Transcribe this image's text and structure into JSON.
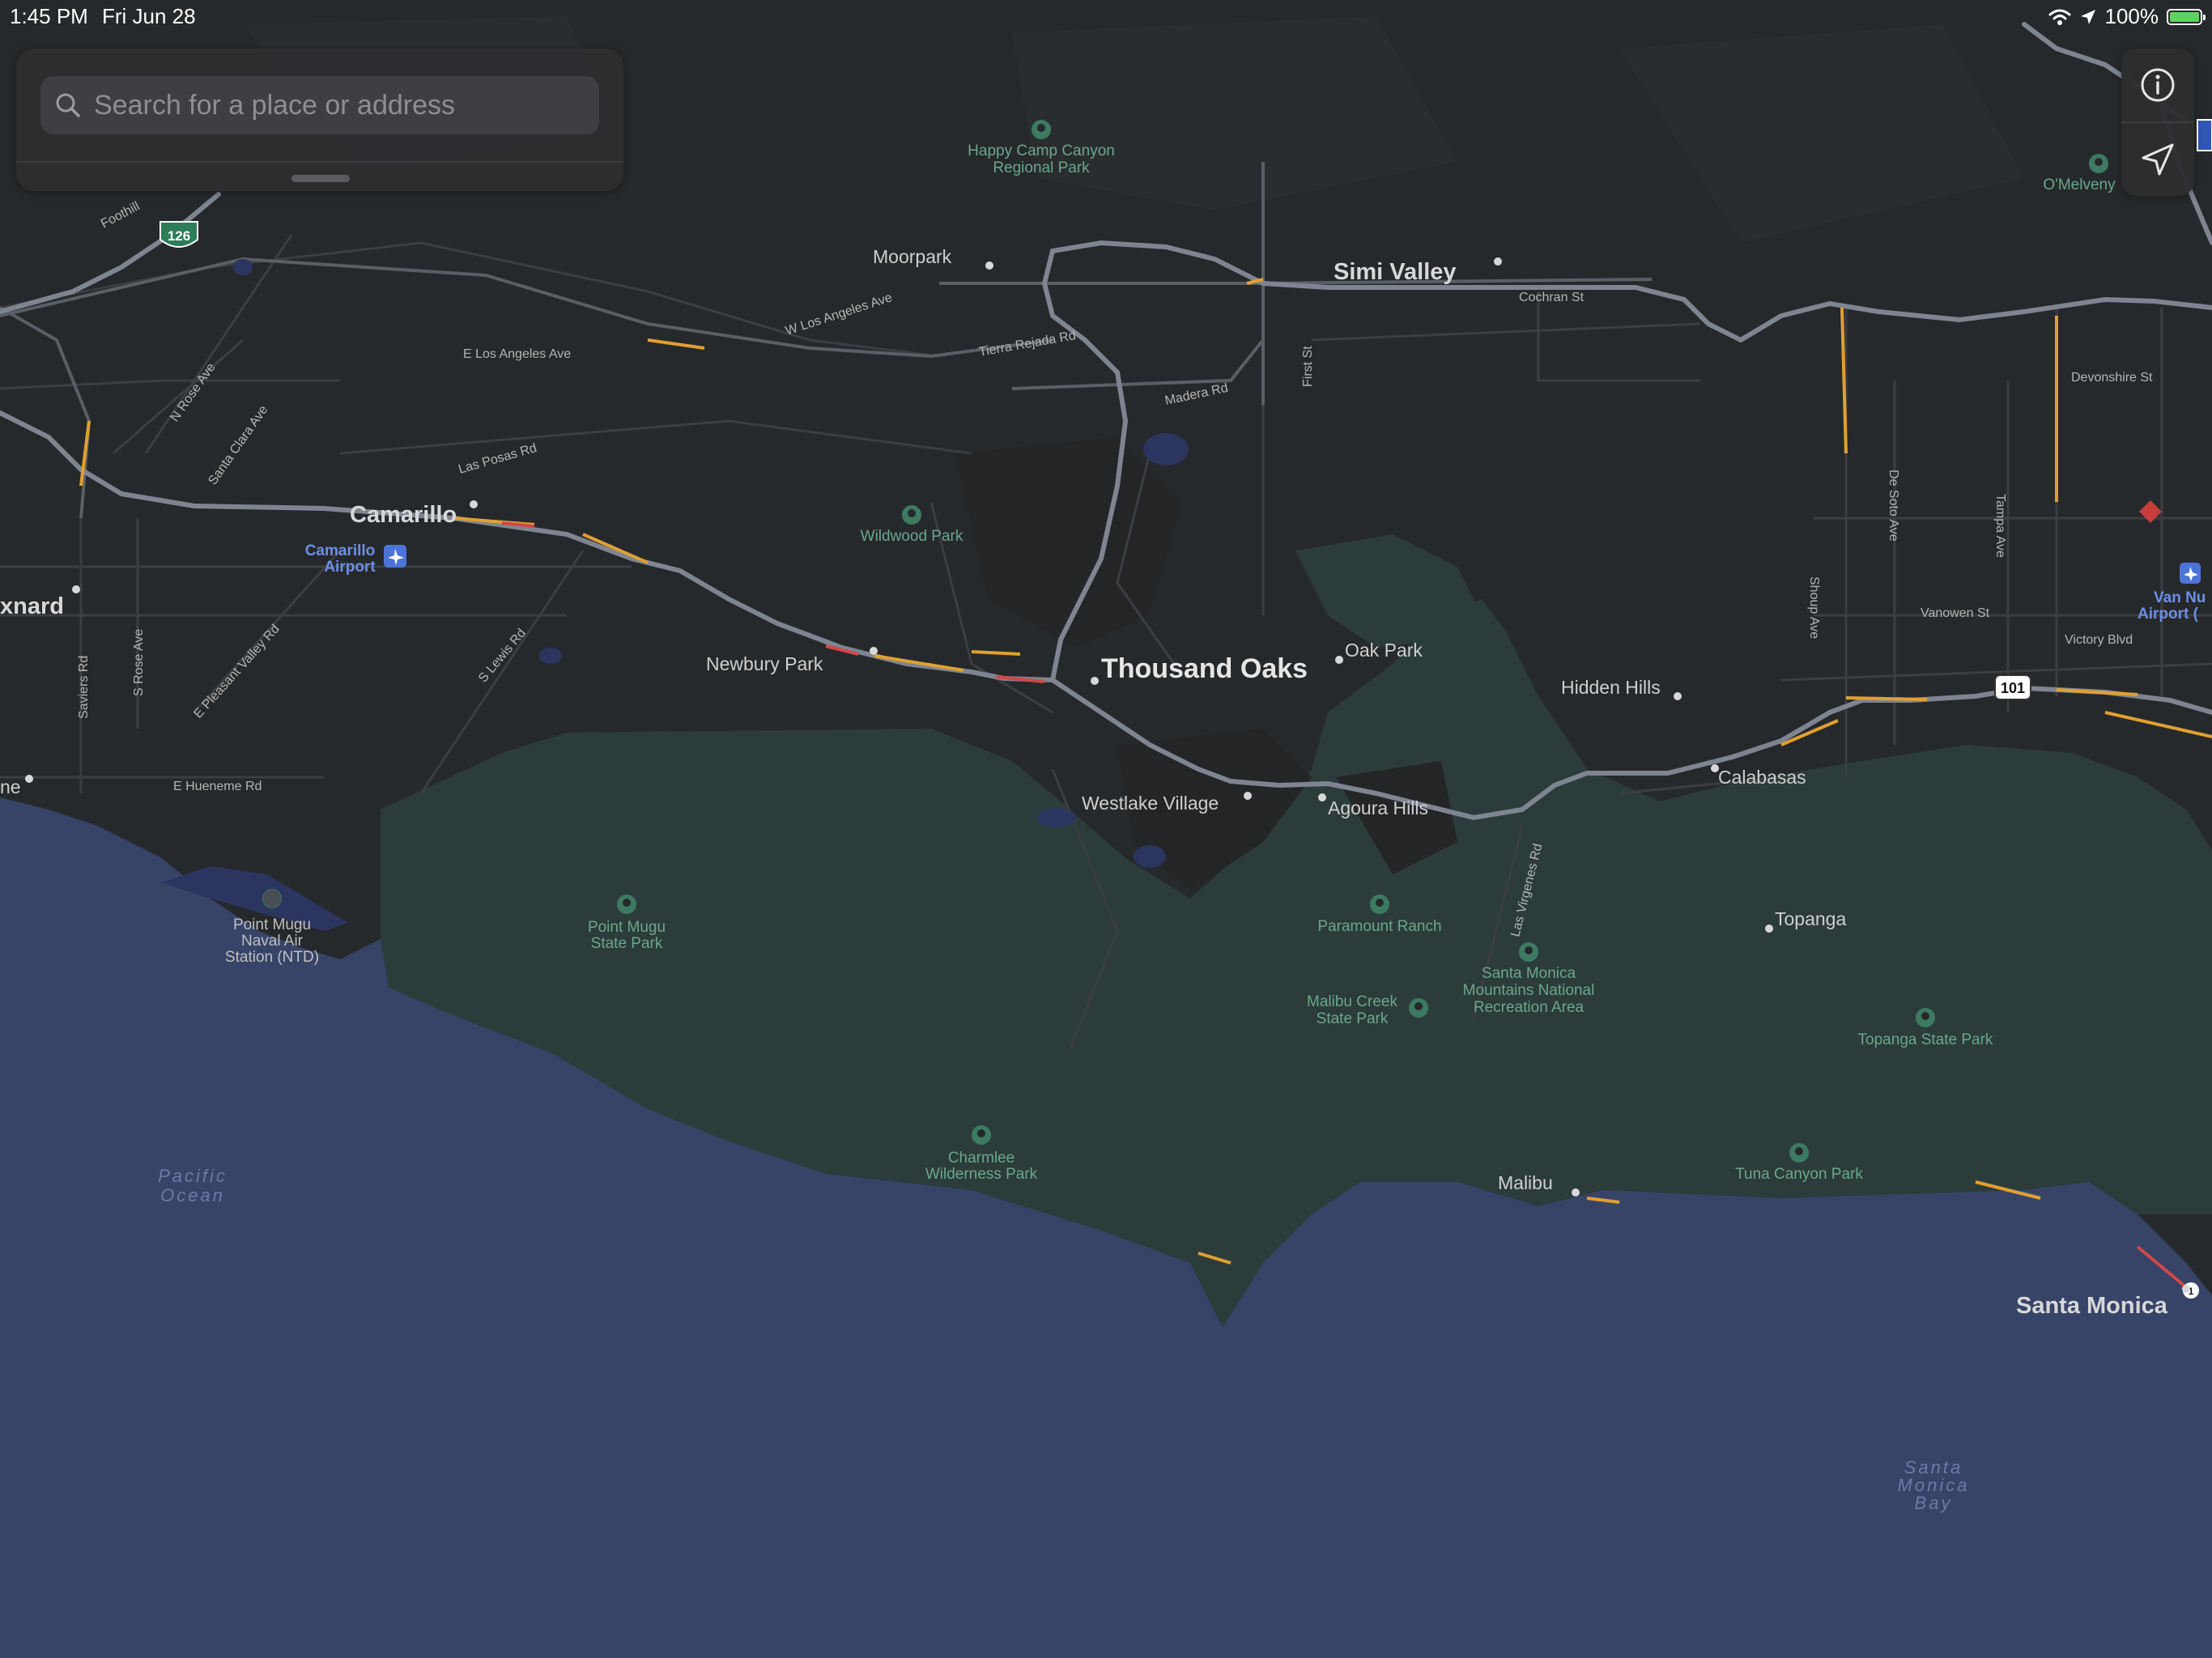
{
  "status_bar": {
    "time": "1:45 PM",
    "date": "Fri Jun 28",
    "battery": "100%"
  },
  "search": {
    "placeholder": "Search for a place or address"
  },
  "controls": {
    "info_icon": "info-circle-icon",
    "location_icon": "location-arrow-icon"
  },
  "map": {
    "colors": {
      "land": "#26292b",
      "park": "#2c3c3a",
      "ocean": "#374468",
      "highway": "#7e8591",
      "traffic_slow": "#e0a030",
      "traffic_heavy": "#d04848",
      "park_label": "#6aa78b",
      "airport_label": "#6d8fe6"
    },
    "cities": {
      "thousand_oaks": "Thousand Oaks",
      "simi_valley": "Simi Valley",
      "camarillo": "Camarillo",
      "santa_monica": "Santa Monica",
      "oxnard": "xnard",
      "newbury_park": "Newbury Park",
      "moorpark": "Moorpark",
      "agoura_hills": "Agoura Hills",
      "calabasas": "Calabasas",
      "malibu": "Malibu",
      "oak_park": "Oak Park",
      "westlake_village": "Westlake Village",
      "hidden_hills": "Hidden Hills",
      "topanga": "Topanga",
      "port_hueneme": "ne",
      "omelveny": "O'Melveny"
    },
    "parks": {
      "happy_camp_1": "Happy Camp Canyon",
      "happy_camp_2": "Regional Park",
      "wildwood": "Wildwood Park",
      "point_mugu_1": "Point Mugu",
      "point_mugu_2": "State Park",
      "paramount": "Paramount Ranch",
      "smm_1": "Santa Monica",
      "smm_2": "Mountains National",
      "smm_3": "Recreation Area",
      "malibu_creek_1": "Malibu Creek",
      "malibu_creek_2": "State Park",
      "topanga_sp": "Topanga State Park",
      "charmlee_1": "Charmlee",
      "charmlee_2": "Wilderness Park",
      "tuna_canyon": "Tuna Canyon Park"
    },
    "airports": {
      "camarillo_1": "Camarillo",
      "camarillo_2": "Airport",
      "van_nuys_1": "Van Nu",
      "van_nuys_2": "Airport ("
    },
    "naval": {
      "line1": "Point Mugu",
      "line2": "Naval Air",
      "line3": "Station (NTD)"
    },
    "water": {
      "pacific_1": "Pacific",
      "pacific_2": "Ocean",
      "smb_1": "Santa",
      "smb_2": "Monica",
      "smb_3": "Bay"
    },
    "shields": {
      "sr126": "126",
      "us101": "101",
      "sr1": "1"
    },
    "streets": {
      "foothill": "Foothill",
      "w_los_angeles": "W Los Angeles Ave",
      "e_los_angeles": "E Los Angeles Ave",
      "tierra_rejada": "Tierra Rejada Rd",
      "madera": "Madera Rd",
      "first": "First St",
      "cochran": "Cochran St",
      "devonshire": "Devonshire St",
      "n_rose": "N Rose Ave",
      "santa_clara": "Santa Clara Ave",
      "las_posas": "Las Posas Rd",
      "saviers": "Saviers Rd",
      "s_rose": "S Rose Ave",
      "e_pleasant_valley": "E Pleasant Valley Rd",
      "s_lewis": "S Lewis Rd",
      "e_hueneme": "E Hueneme Rd",
      "de_soto": "De Soto Ave",
      "tampa": "Tampa Ave",
      "shoup": "Shoup Ave",
      "vanowen": "Vanowen St",
      "victory": "Victory Blvd",
      "las_virgenes": "Las Virgenes Rd"
    }
  }
}
